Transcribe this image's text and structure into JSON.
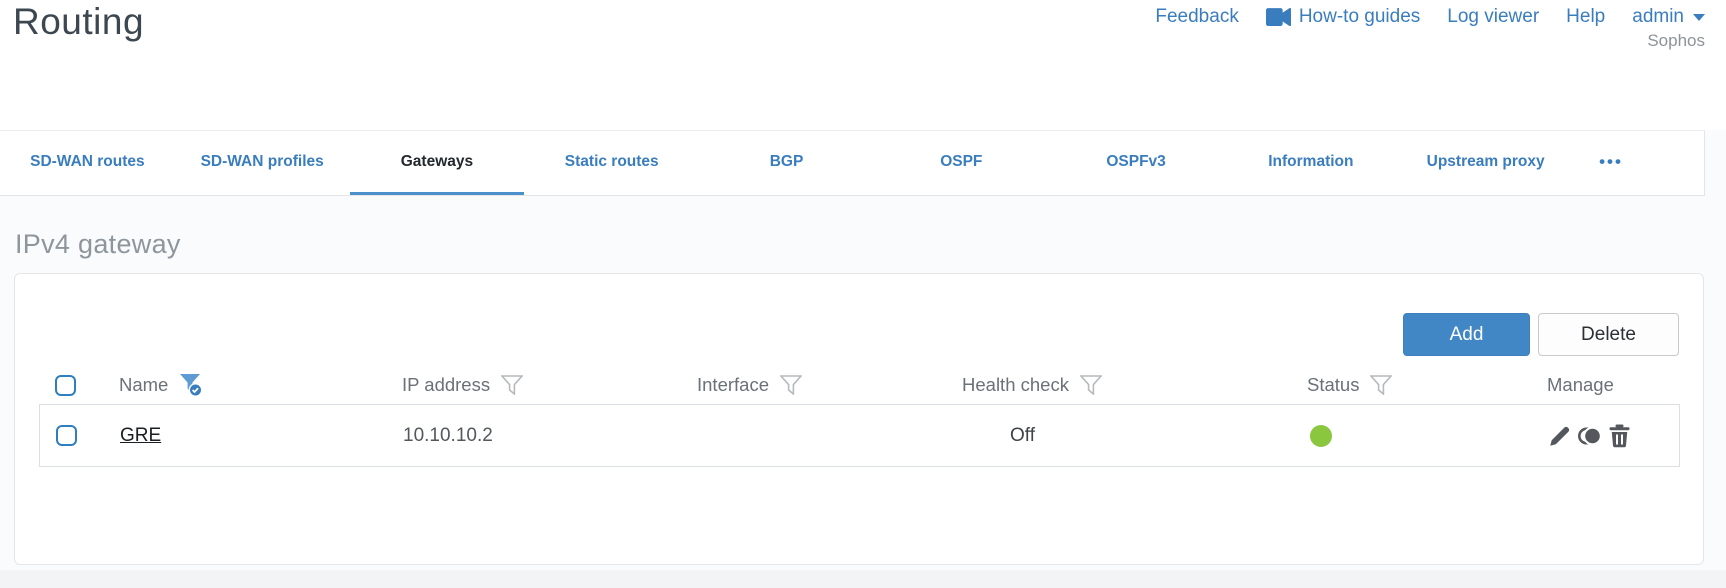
{
  "page": {
    "title": "Routing",
    "brand": "Sophos"
  },
  "nav": {
    "feedback": "Feedback",
    "how_to_guides": "How-to guides",
    "log_viewer": "Log viewer",
    "help": "Help",
    "user": "admin"
  },
  "tabs": {
    "items": [
      {
        "label": "SD-WAN routes",
        "active": false
      },
      {
        "label": "SD-WAN profiles",
        "active": false
      },
      {
        "label": "Gateways",
        "active": true
      },
      {
        "label": "Static routes",
        "active": false
      },
      {
        "label": "BGP",
        "active": false
      },
      {
        "label": "OSPF",
        "active": false
      },
      {
        "label": "OSPFv3",
        "active": false
      },
      {
        "label": "Information",
        "active": false
      },
      {
        "label": "Upstream proxy",
        "active": false
      },
      {
        "label": "•••",
        "active": false
      }
    ]
  },
  "section": {
    "title": "IPv4 gateway"
  },
  "toolbar": {
    "add": "Add",
    "delete": "Delete"
  },
  "table": {
    "columns": {
      "name": "Name",
      "ip": "IP address",
      "interface": "Interface",
      "health": "Health check",
      "status": "Status",
      "manage": "Manage"
    },
    "filters": {
      "name": "active",
      "ip": "inactive",
      "interface": "inactive",
      "health": "inactive",
      "status": "inactive"
    },
    "rows": [
      {
        "name": "GRE",
        "ip": "10.10.10.2",
        "interface": "",
        "health": "Off",
        "status": "up",
        "status_color": "#8bc63f"
      }
    ]
  },
  "colors": {
    "accent_blue": "#3a7dbf",
    "status_green": "#8bc63f"
  }
}
